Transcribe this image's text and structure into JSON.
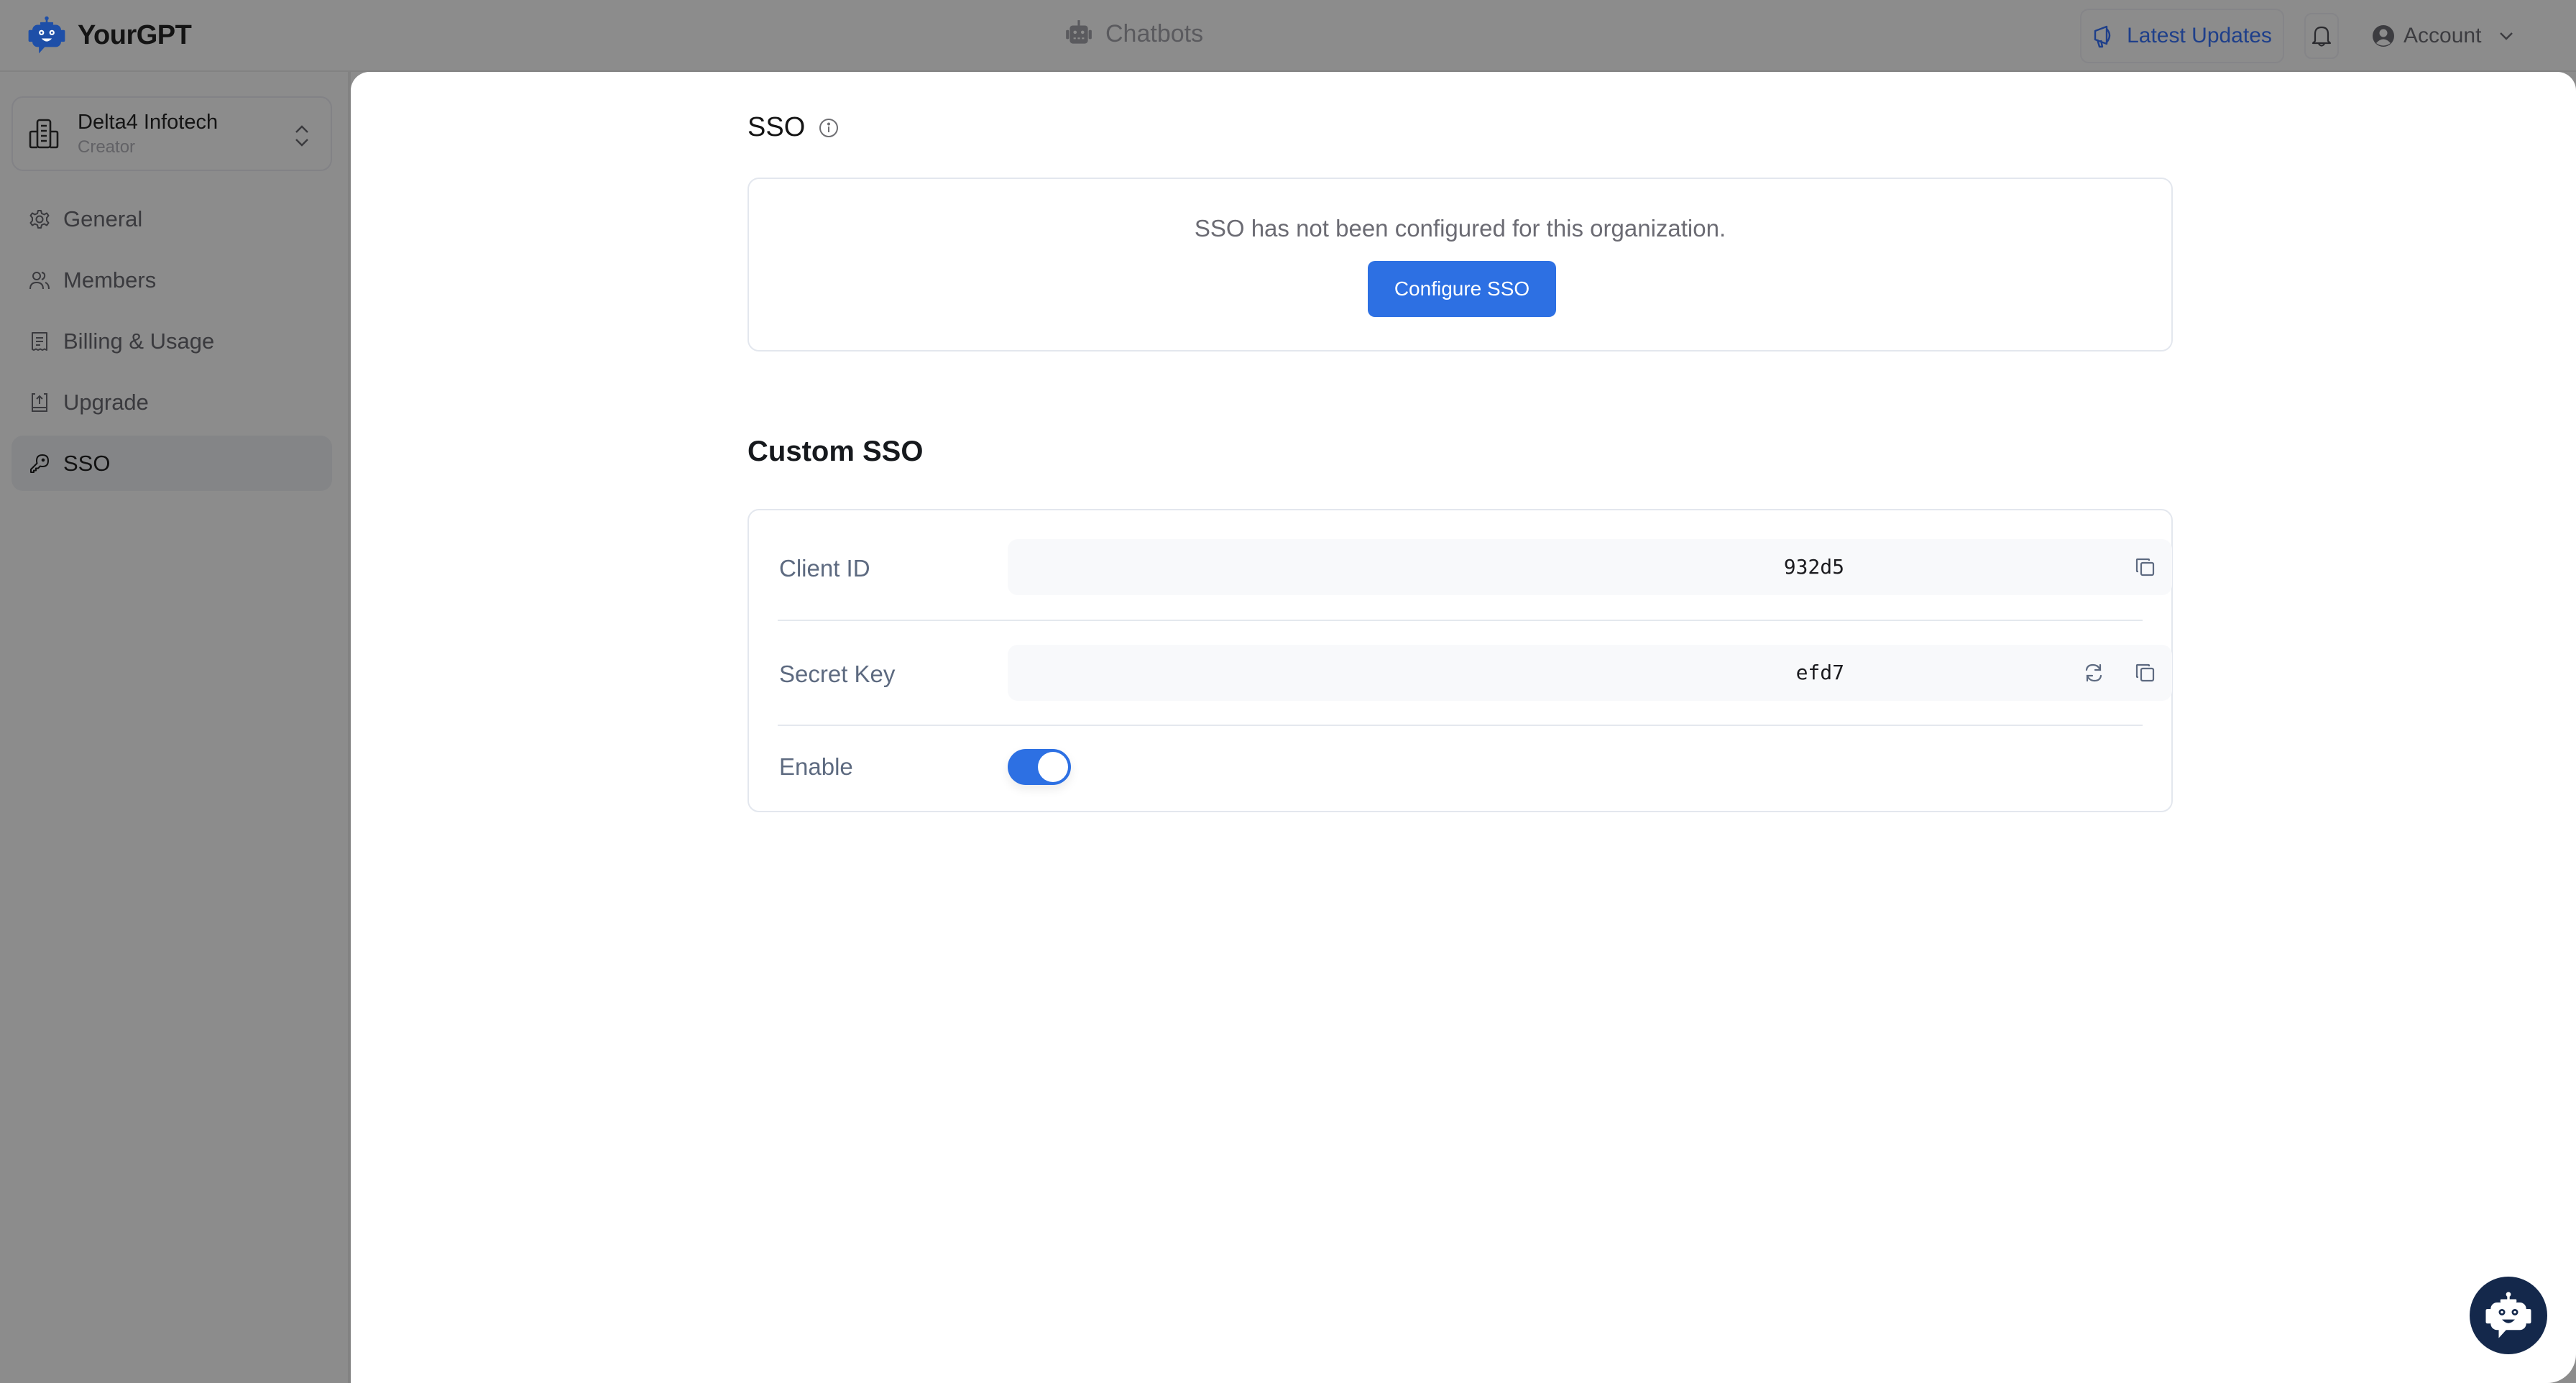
{
  "header": {
    "brand_name": "YourGPT",
    "center_nav_label": "Chatbots",
    "latest_updates_label": "Latest Updates",
    "account_label": "Account",
    "colors": {
      "brand": "#1e4fa8",
      "updates_text": "#1e3f8a"
    }
  },
  "sidebar": {
    "org": {
      "name": "Delta4 Infotech",
      "role": "Creator"
    },
    "items": [
      {
        "label": "General",
        "icon": "gear-icon",
        "active": false
      },
      {
        "label": "Members",
        "icon": "users-icon",
        "active": false
      },
      {
        "label": "Billing & Usage",
        "icon": "receipt-icon",
        "active": false
      },
      {
        "label": "Upgrade",
        "icon": "upgrade-icon",
        "active": false
      },
      {
        "label": "SSO",
        "icon": "key-icon",
        "active": true
      }
    ]
  },
  "main": {
    "sso_section": {
      "title": "SSO",
      "info_text": "SSO has not been configured for this organization.",
      "configure_button_label": "Configure SSO"
    },
    "custom_sso": {
      "title": "Custom SSO",
      "client_id": {
        "label": "Client ID",
        "value": "932d5"
      },
      "secret_key": {
        "label": "Secret Key",
        "value": "efd7"
      },
      "enable": {
        "label": "Enable",
        "checked": true
      }
    },
    "colors": {
      "primary": "#2d70e3",
      "chat_widget": "#14284b"
    }
  }
}
